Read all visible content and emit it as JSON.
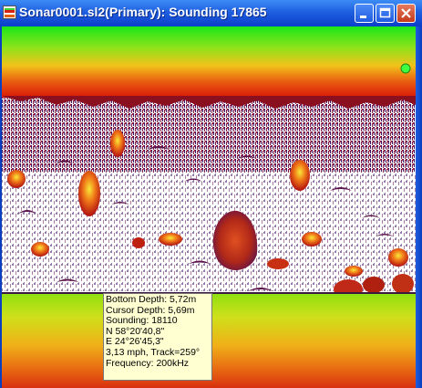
{
  "window": {
    "title": "Sonar0001.sl2(Primary): Sounding 17865",
    "icon": "sonar-app-icon",
    "controls": [
      "minimize-icon",
      "maximize-icon",
      "close-icon"
    ]
  },
  "colors": {
    "titlebar": "#1f5fe0",
    "surface_band": "#19e619",
    "return_red": "#d81808",
    "return_orange": "#f07818",
    "return_yellow": "#f8e838",
    "noise_purple": "#3a1068",
    "water_white": "#ffffff",
    "bottom_green": "#9be010",
    "readout_bg": "#ffffd2"
  },
  "readout": {
    "bottom_depth": "Bottom Depth: 5,72m",
    "cursor_depth": "Cursor Depth: 5,69m",
    "sounding": "Sounding: 18110",
    "latitude": "N 58°20'40,8\"",
    "longitude": "E  24°26'45,3\"",
    "speed_track": "3,13 mph, Track=259°",
    "frequency": "Frequency: 200kHz"
  }
}
